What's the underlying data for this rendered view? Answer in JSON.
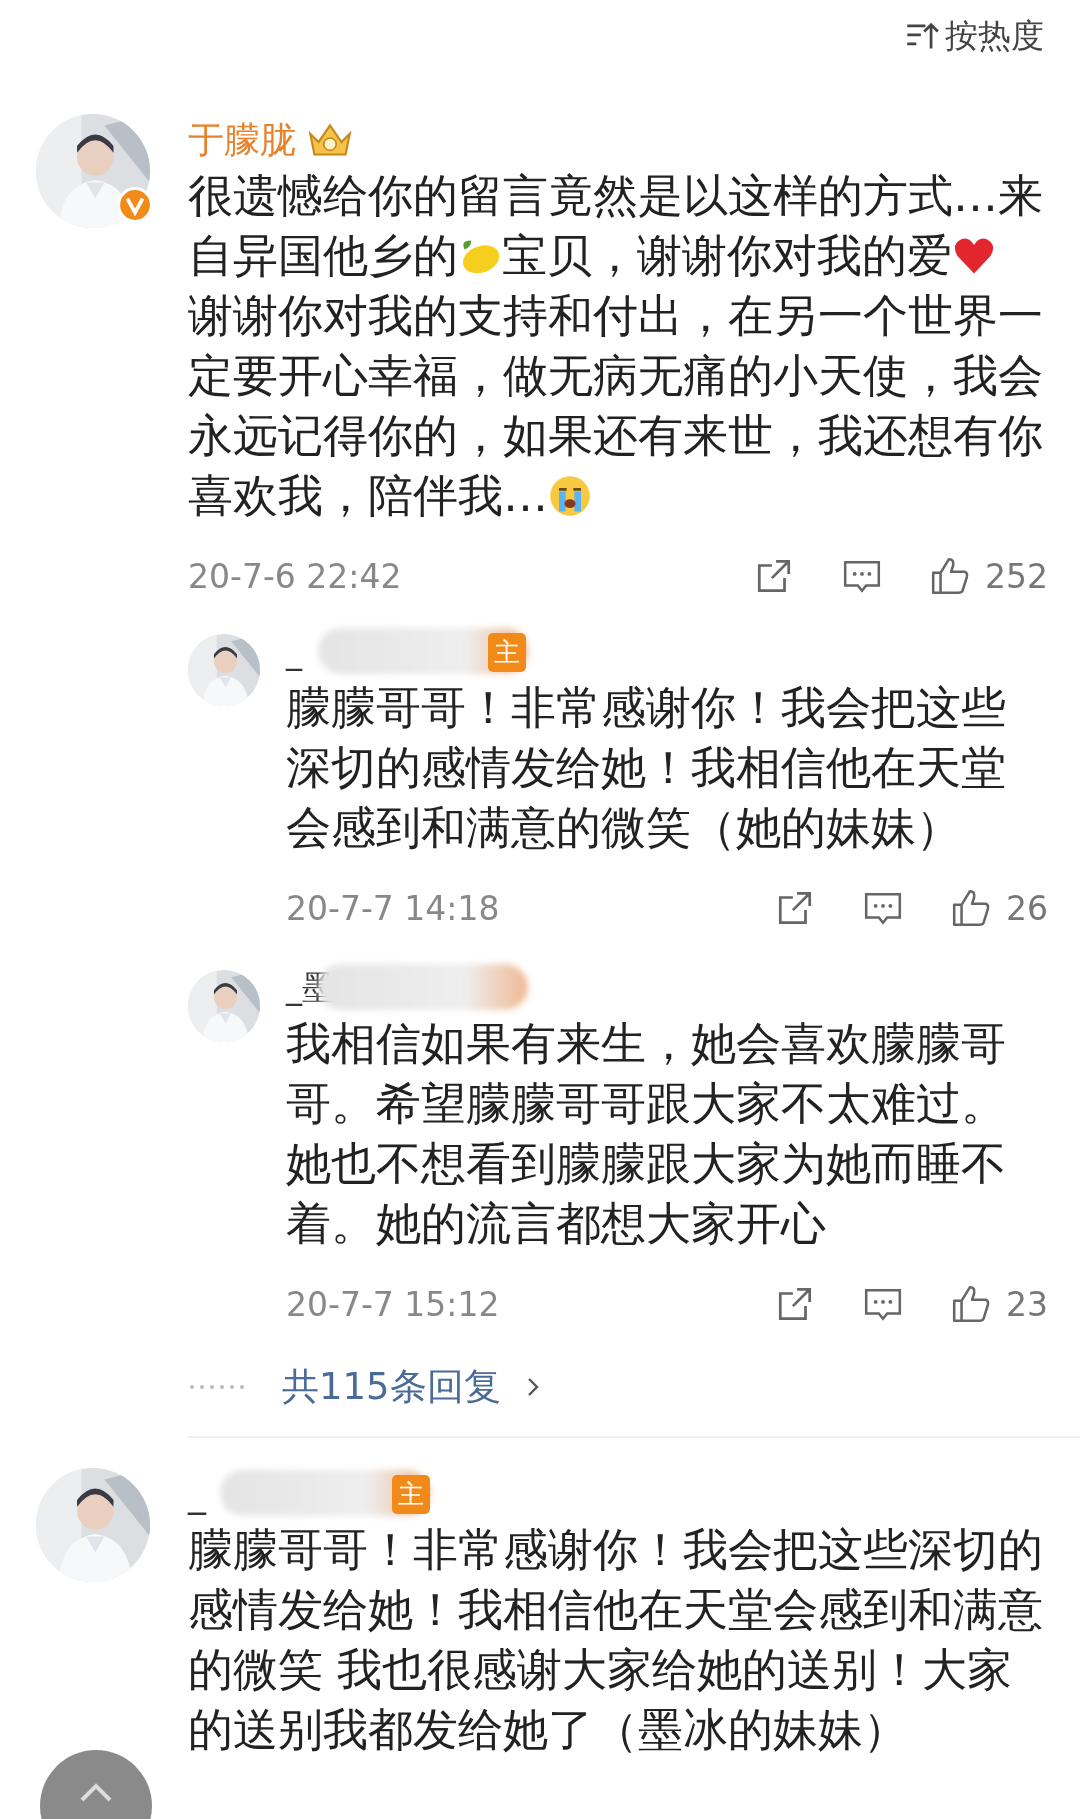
{
  "sort_button": {
    "label": "按热度"
  },
  "comments": [
    {
      "author": "于朦胧",
      "verified": true,
      "crown": true,
      "name_blurred": false,
      "text": [
        {
          "kind": "text",
          "text": "很遗憾给你的留言竟然是以这样的方式…来"
        },
        {
          "kind": "text",
          "text": "自异国他乡的"
        },
        {
          "kind": "lemon"
        },
        {
          "kind": "text",
          "text": "宝贝，谢谢你对我的爱"
        },
        {
          "kind": "heart"
        },
        {
          "kind": "text",
          "text": "谢谢你对我的支持和付出，在另一个世界一定要开心幸福，做无病无痛的小天使，我会永远记得你的，如果还有来世，我还想有你"
        },
        {
          "kind": "text",
          "text": "喜欢我，陪伴我…"
        },
        {
          "kind": "crying"
        }
      ],
      "time": "20-7-6 22:42",
      "likes": "252",
      "replies": [
        {
          "author": "_",
          "name_blurred": true,
          "badge": "主",
          "text": "朦朦哥哥！非常感谢你！我会把这些深切的感情发给她！我相信他在天堂会感到和满意的微笑（她的妹妹）",
          "time": "20-7-7 14:18",
          "likes": "26"
        },
        {
          "author": "_墨",
          "name_blurred": true,
          "text": "我相信如果有来生，她会喜欢朦朦哥哥。希望朦朦哥哥跟大家不太难过。她也不想看到朦朦跟大家为她而睡不着。她的流言都想大家开心",
          "time": "20-7-7 15:12",
          "likes": "23"
        }
      ],
      "more_replies": "共115条回复"
    },
    {
      "author": "_",
      "verified": false,
      "crown": false,
      "name_blurred": true,
      "badge": "主",
      "text": [
        {
          "kind": "text",
          "text": "朦朦哥哥！非常感谢你！我会把这些深切的感情发给她！我相信他在天堂会感到和满意的微笑 我也很感谢大家给她的送别！大家的送别我都发给她了（墨冰的妹妹）"
        }
      ]
    }
  ]
}
